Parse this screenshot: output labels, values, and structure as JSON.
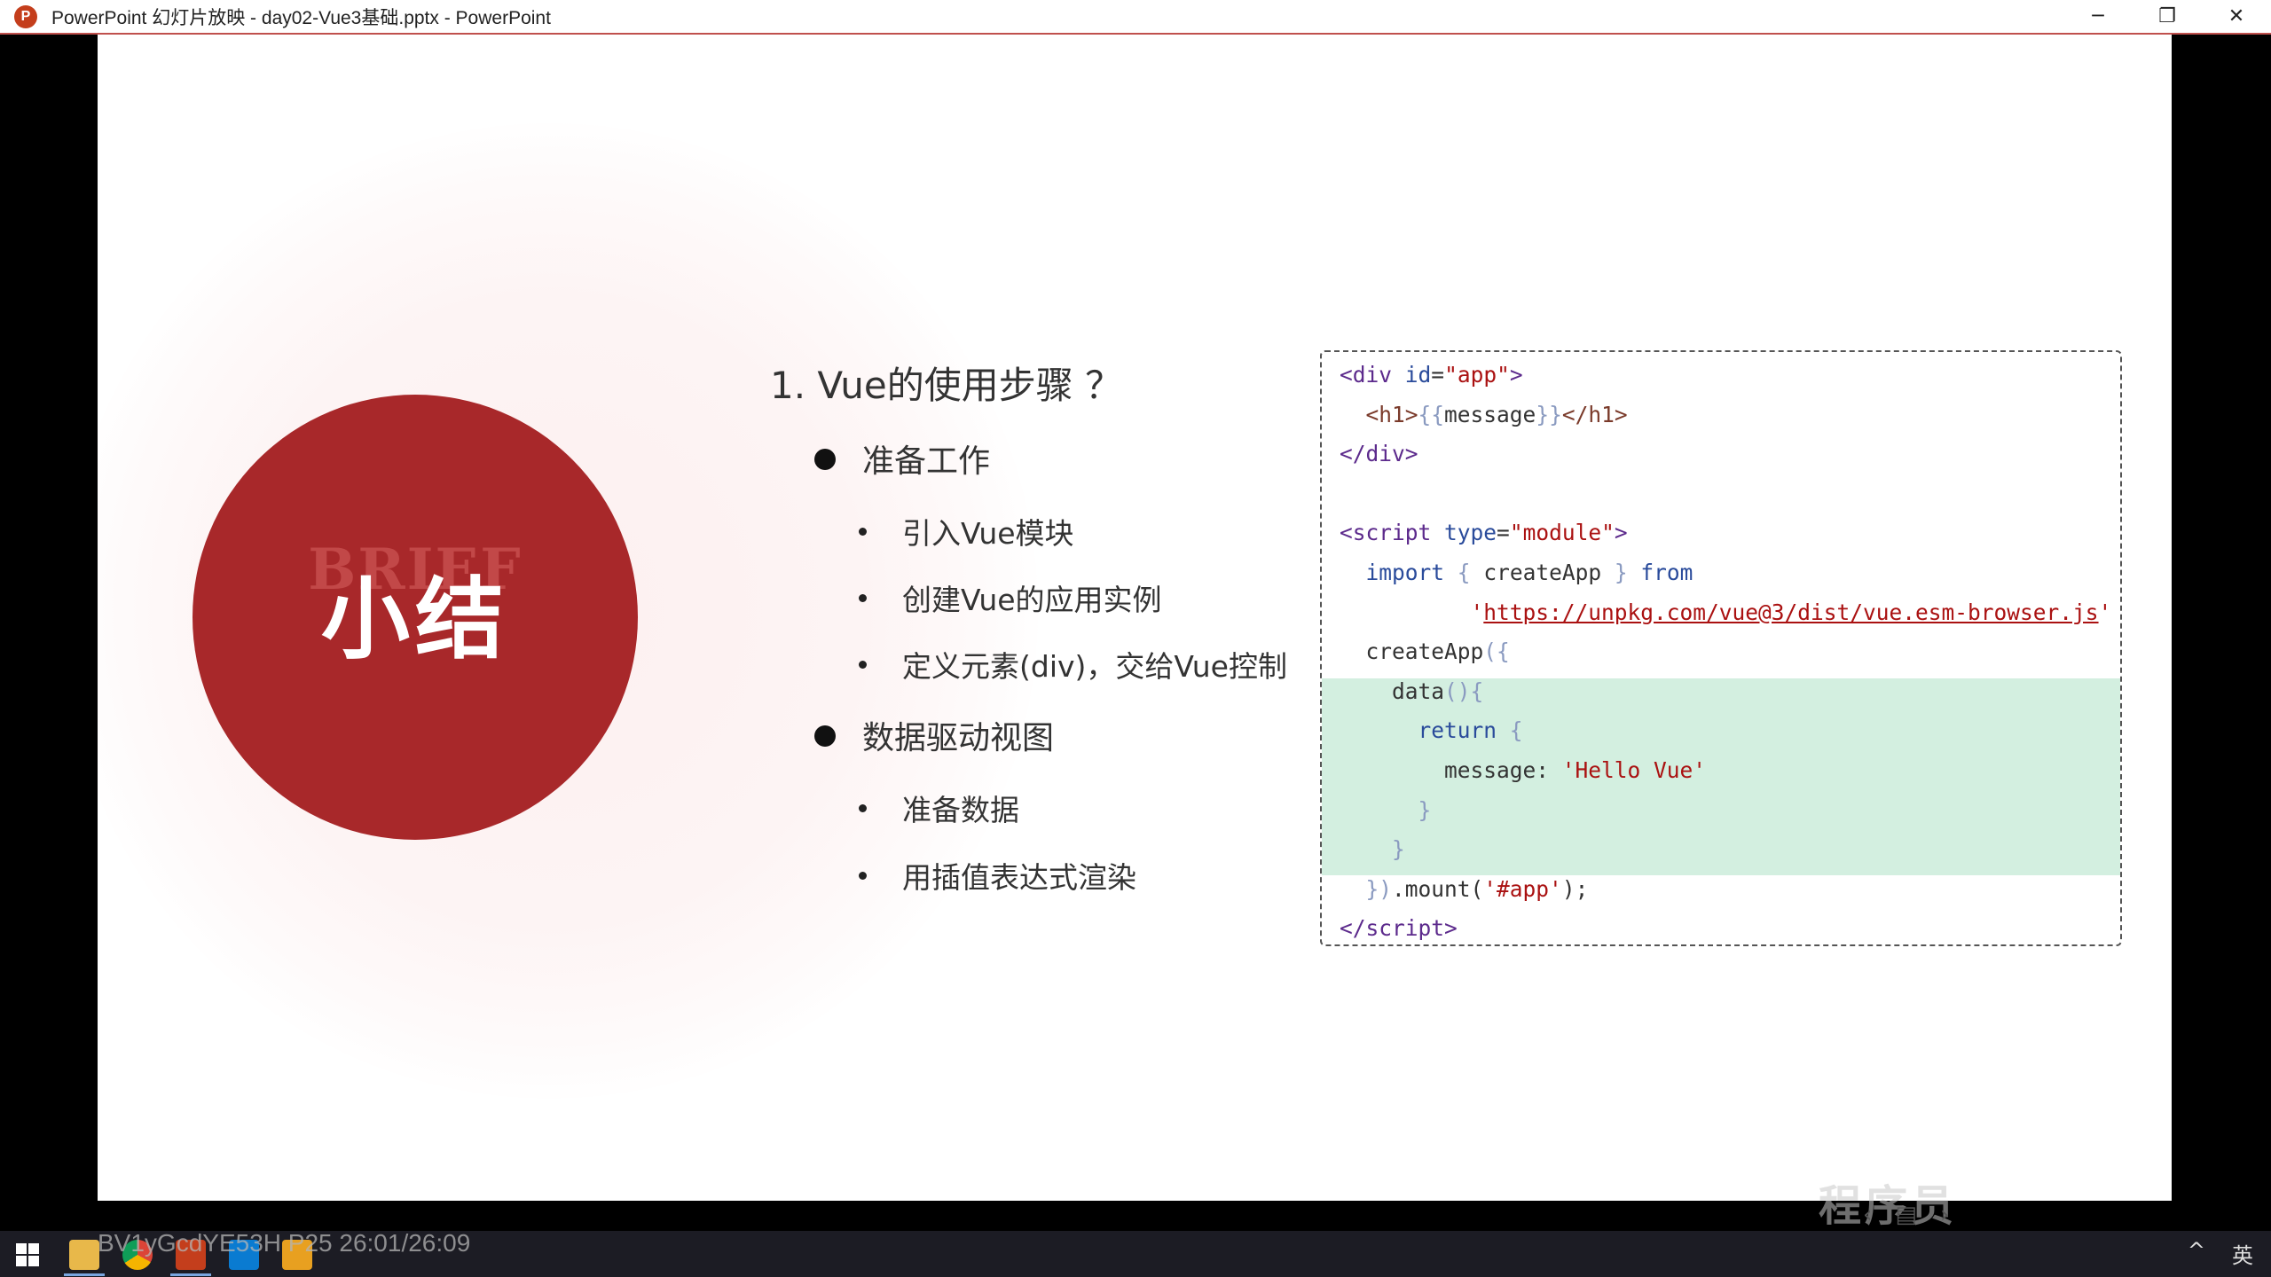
{
  "window": {
    "title": "PowerPoint 幻灯片放映  -  day02-Vue3基础.pptx - PowerPoint",
    "logo_letter": "P",
    "controls": {
      "minimize": "─",
      "restore": "❐",
      "close": "✕"
    }
  },
  "slide": {
    "circle_bg_text": "BRIEF",
    "circle_text": "小结",
    "steps_title": "1. Vue的使用步骤 ？",
    "sections": [
      {
        "label": "准备工作",
        "items": [
          "引入Vue模块",
          "创建Vue的应用实例",
          "定义元素(div)，交给Vue控制"
        ]
      },
      {
        "label": "数据驱动视图",
        "items": [
          "准备数据",
          "用插值表达式渲染"
        ]
      }
    ],
    "code": {
      "highlight_color": "#d3efe0",
      "url": "https://unpkg.com/vue@3/dist/vue.esm-browser.js"
    }
  },
  "slideshow_nav": {
    "prev": "‹",
    "slide_icon": "▤",
    "next": "›"
  },
  "watermark": "程序员",
  "taskbar": {
    "overlay": "BV1yGcdYE53H P25 26:01/26:09",
    "tray_ime": "英",
    "tray_chevron": "^"
  },
  "colors": {
    "accent_red": "#a8282a",
    "title_border": "#c0504d"
  }
}
